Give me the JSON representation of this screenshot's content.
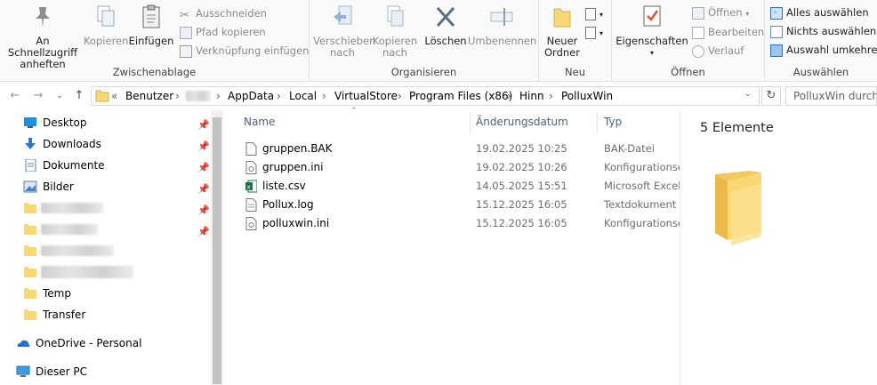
{
  "ribbon": {
    "zwischenablage": {
      "label": "Zwischenablage",
      "pin_label": "An Schnellzugriff anheften",
      "copy_label": "Kopieren",
      "paste_label": "Einfügen",
      "cut_label": "Ausschneiden",
      "copy_path_label": "Pfad kopieren",
      "paste_shortcut_label": "Verknüpfung einfügen"
    },
    "organisieren": {
      "label": "Organisieren",
      "move_label": "Verschieben nach",
      "copy_to_label": "Kopieren nach",
      "delete_label": "Löschen",
      "rename_label": "Umbenennen"
    },
    "neu": {
      "label": "Neu",
      "new_folder_label": "Neuer Ordner"
    },
    "oeffnen": {
      "label": "Öffnen",
      "properties_label": "Eigenschaften",
      "open_label": "Öffnen",
      "edit_label": "Bearbeiten",
      "history_label": "Verlauf"
    },
    "auswaehlen": {
      "label": "Auswählen",
      "select_all_label": "Alles auswählen",
      "select_none_label": "Nichts auswählen",
      "invert_label": "Auswahl umkehren"
    }
  },
  "address": {
    "overflow": "«",
    "crumbs": [
      "Benutzer",
      "AppData",
      "Local",
      "VirtualStore",
      "Program Files (x86)",
      "Hinn",
      "PolluxWin"
    ],
    "search_placeholder": "PolluxWin durchsuchen"
  },
  "nav": {
    "items": [
      {
        "label": "Desktop",
        "icon": "desktop-icon"
      },
      {
        "label": "Downloads",
        "icon": "download-icon"
      },
      {
        "label": "Dokumente",
        "icon": "documents-icon"
      },
      {
        "label": "Bilder",
        "icon": "pictures-icon"
      },
      {
        "label": "Temp",
        "icon": "folder-icon"
      },
      {
        "label": "Transfer",
        "icon": "folder-icon"
      },
      {
        "label": "OneDrive - Personal",
        "icon": "onedrive-icon"
      },
      {
        "label": "Dieser PC",
        "icon": "pc-icon"
      }
    ]
  },
  "files": {
    "columns": {
      "name": "Name",
      "date": "Änderungsdatum",
      "type": "Typ"
    },
    "rows": [
      {
        "name": "gruppen.BAK",
        "date": "19.02.2025 10:25",
        "type": "BAK-Datei",
        "icon": "file-icon"
      },
      {
        "name": "gruppen.ini",
        "date": "19.02.2025 10:26",
        "type": "Konfigurationseinstellungen",
        "icon": "ini-file-icon"
      },
      {
        "name": "liste.csv",
        "date": "14.05.2025 15:51",
        "type": "Microsoft Excel",
        "icon": "excel-file-icon"
      },
      {
        "name": "Pollux.log",
        "date": "15.12.2025 16:05",
        "type": "Textdokument",
        "icon": "text-file-icon"
      },
      {
        "name": "polluxwin.ini",
        "date": "15.12.2025 16:05",
        "type": "Konfigurationseinstellungen",
        "icon": "ini-file-icon"
      }
    ]
  },
  "preview": {
    "count_label": "5 Elemente"
  },
  "colors": {
    "folder": "#f8d775",
    "accent": "#1f6fd1",
    "header_text": "#4c607a"
  }
}
